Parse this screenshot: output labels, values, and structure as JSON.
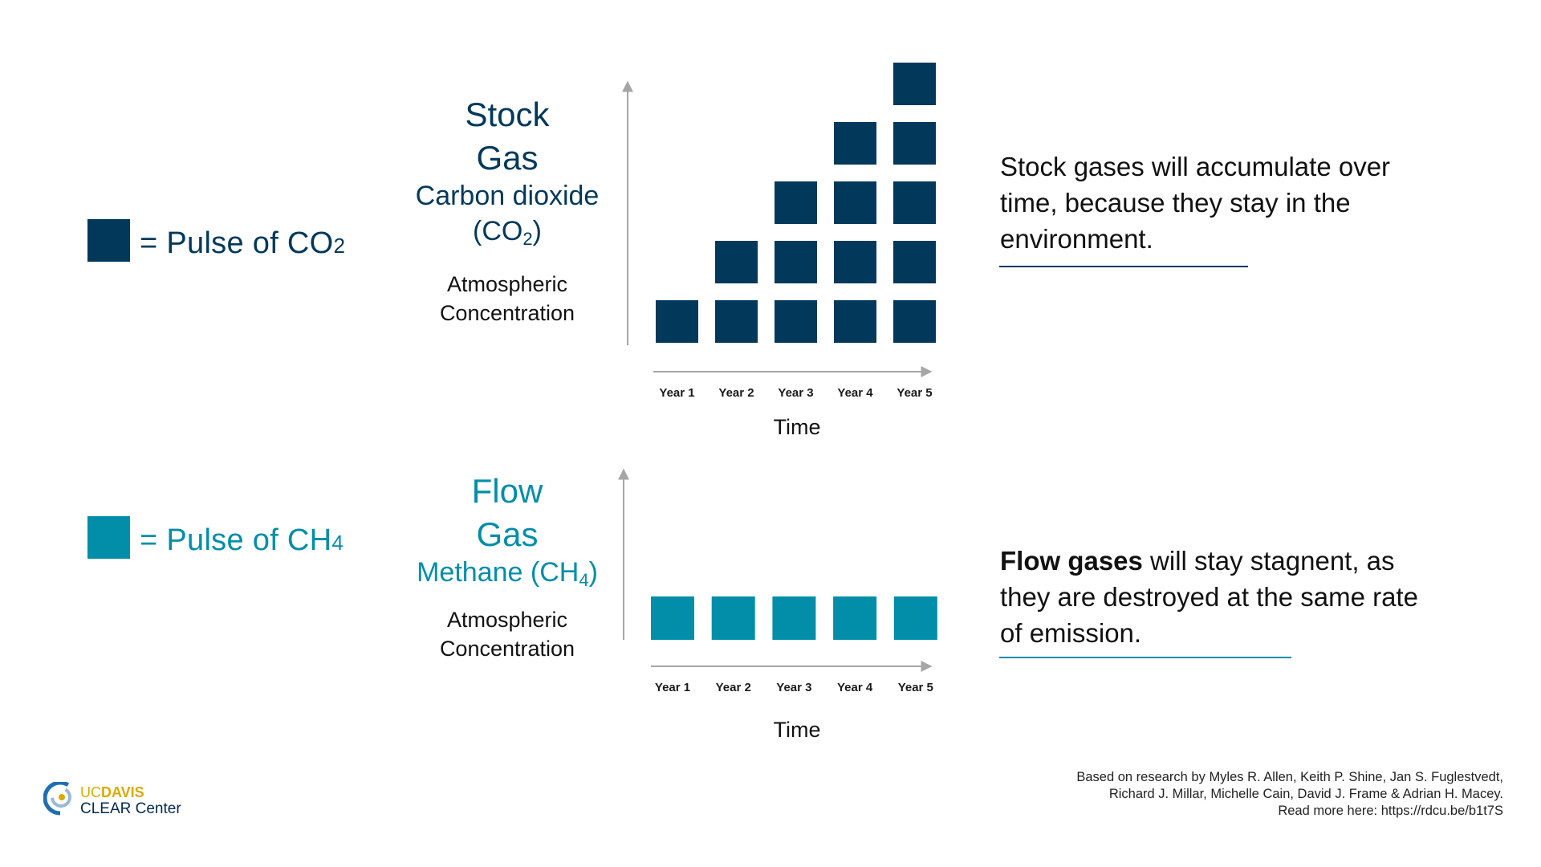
{
  "colors": {
    "stock": "#02395b",
    "flow": "#028ea9",
    "axis": "#a6a6a6",
    "text": "#111111",
    "logo_gold": "#daaa00",
    "logo_navy": "#022851",
    "logo_blue": "#1f6fb2",
    "logo_light": "#9ab9d8"
  },
  "legend": [
    {
      "prefix": "=",
      "label": "Pulse of CO",
      "subscript": "2"
    },
    {
      "prefix": "=",
      "label": "Pulse of CH",
      "subscript": "4"
    }
  ],
  "stock": {
    "title_line1": "Stock",
    "title_line2": "Gas",
    "gas_name": "Carbon dioxide",
    "formula_open": "(CO",
    "formula_sub": "2",
    "formula_close": ")",
    "axis_label_line1": "Atmospheric",
    "axis_label_line2": "Concentration",
    "description_bold": "",
    "description": "Stock gases will accumulate over time, because they stay in the environment."
  },
  "flow": {
    "title_line1": "Flow",
    "title_line2": "Gas",
    "gas_name": "Methane (CH",
    "formula_sub": "4",
    "formula_close": ")",
    "axis_label_line1": "Atmospheric",
    "axis_label_line2": "Concentration",
    "description_bold": "Flow gases",
    "description": " will stay stagnent, as they are destroyed at the same rate of emission."
  },
  "chart_data": [
    {
      "type": "bar",
      "title": "Stock Gas — Carbon dioxide (CO2)",
      "xlabel": "Time",
      "ylabel": "Atmospheric Concentration",
      "categories": [
        "Year 1",
        "Year 2",
        "Year 3",
        "Year 4",
        "Year 5"
      ],
      "values": [
        1,
        2,
        3,
        4,
        5
      ],
      "unit": "pulses of CO2 (stacked squares)",
      "ylim": [
        0,
        5
      ]
    },
    {
      "type": "bar",
      "title": "Flow Gas — Methane (CH4)",
      "xlabel": "Time",
      "ylabel": "Atmospheric Concentration",
      "categories": [
        "Year 1",
        "Year 2",
        "Year 3",
        "Year 4",
        "Year 5"
      ],
      "values": [
        1,
        1,
        1,
        1,
        1
      ],
      "unit": "pulses of CH4 (squares)",
      "ylim": [
        0,
        5
      ]
    }
  ],
  "credits": {
    "line1": "Based on research by Myles R. Allen, Keith P. Shine, Jan S. Fuglestvedt,",
    "line2": "Richard J. Millar, Michelle Cain, David J. Frame & Adrian H. Macey.",
    "line3": "Read more here: https://rdcu.be/b1t7S"
  },
  "logo": {
    "uc": "UC",
    "davis": "DAVIS",
    "center": "CLEAR Center"
  }
}
